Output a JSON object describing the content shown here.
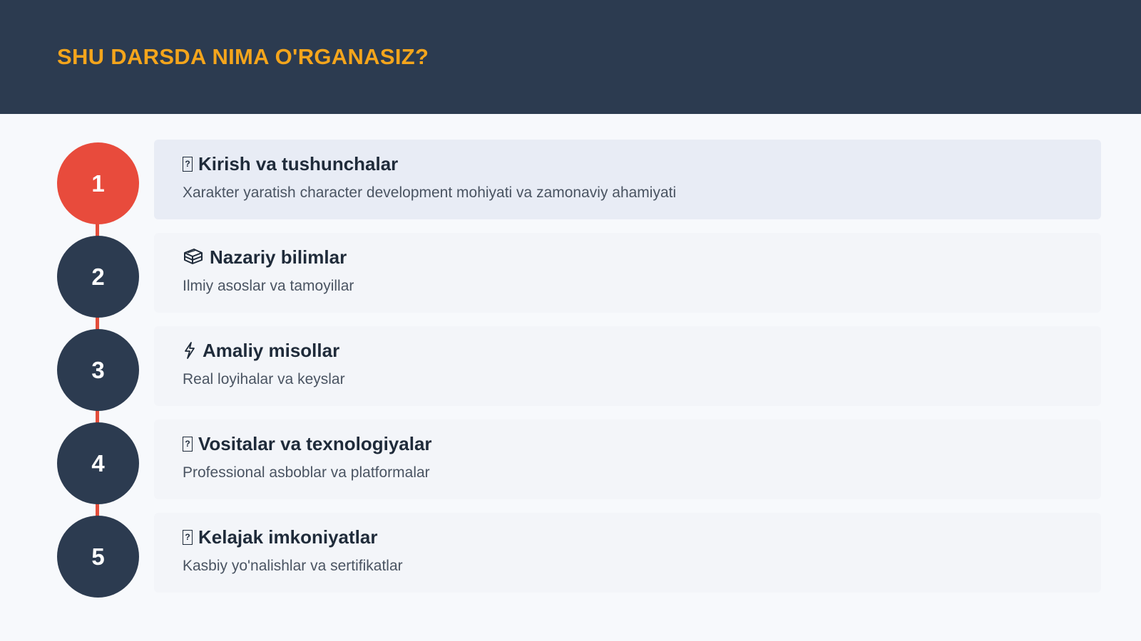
{
  "header": {
    "title": "SHU DARSDA NIMA O'RGANASIZ?"
  },
  "colors": {
    "header_bg": "#2c3b50",
    "title_accent": "#f4a51c",
    "active_step": "#e84b3c",
    "inactive_step": "#2c3b50",
    "connector": "#e34d3b"
  },
  "steps": [
    {
      "number": "1",
      "icon": "missing-glyph-icon",
      "title": "Kirish va tushunchalar",
      "description": "Xarakter yaratish character development mohiyati va zamonaviy ahamiyati",
      "active": true
    },
    {
      "number": "2",
      "icon": "books-icon",
      "title": "Nazariy bilimlar",
      "description": "Ilmiy asoslar va tamoyillar",
      "active": false
    },
    {
      "number": "3",
      "icon": "lightning-icon",
      "title": "Amaliy misollar",
      "description": "Real loyihalar va keyslar",
      "active": false
    },
    {
      "number": "4",
      "icon": "missing-glyph-icon",
      "title": "Vositalar va texnologiyalar",
      "description": "Professional asboblar va platformalar",
      "active": false
    },
    {
      "number": "5",
      "icon": "missing-glyph-icon",
      "title": "Kelajak imkoniyatlar",
      "description": "Kasbiy yo'nalishlar va sertifikatlar",
      "active": false
    }
  ]
}
